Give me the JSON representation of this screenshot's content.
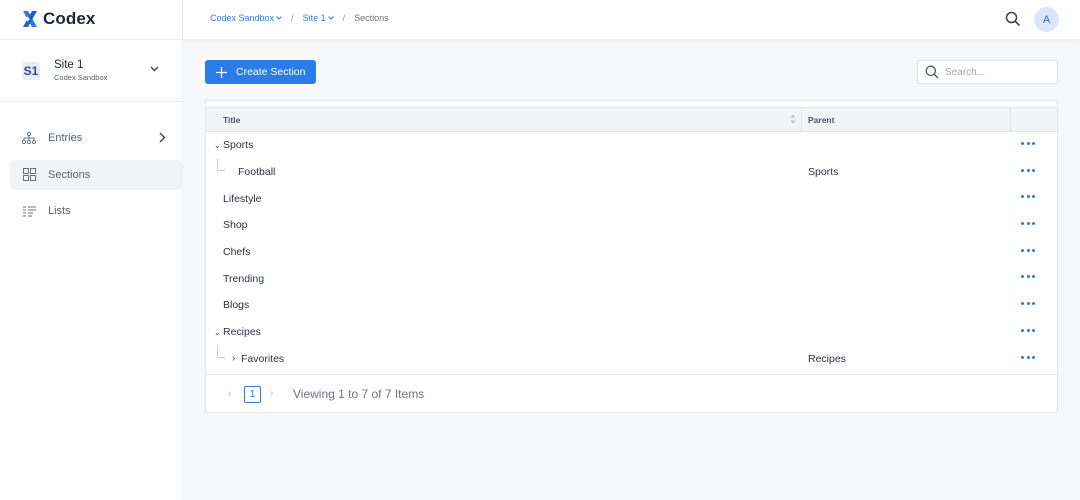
{
  "app": {
    "name": "Codex",
    "brand_color": "#2b7be9"
  },
  "site_switcher": {
    "badge": "S1",
    "name": "Site 1",
    "workspace": "Codex Sandbox"
  },
  "sidebar": {
    "items": [
      {
        "label": "Entries",
        "icon": "hierarchy-icon",
        "active": false
      },
      {
        "label": "Sections",
        "icon": "grid-icon",
        "active": true
      },
      {
        "label": "Lists",
        "icon": "list-icon",
        "active": false
      }
    ]
  },
  "breadcrumb": {
    "workspace": "Codex Sandbox",
    "site": "Site 1",
    "current": "Sections"
  },
  "user": {
    "initial": "A"
  },
  "toolbar": {
    "create_label": "Create Section",
    "search_placeholder": "Search..."
  },
  "table": {
    "columns": {
      "title": "Title",
      "parent": "Parent"
    },
    "rows": [
      {
        "title": "Sports",
        "parent": "",
        "expanded": true,
        "child": false
      },
      {
        "title": "Football",
        "parent": "Sports",
        "expanded": false,
        "child": true
      },
      {
        "title": "Lifestyle",
        "parent": "",
        "expanded": false,
        "child": false
      },
      {
        "title": "Shop",
        "parent": "",
        "expanded": false,
        "child": false
      },
      {
        "title": "Chefs",
        "parent": "",
        "expanded": false,
        "child": false
      },
      {
        "title": "Trending",
        "parent": "",
        "expanded": false,
        "child": false
      },
      {
        "title": "Blogs",
        "parent": "",
        "expanded": false,
        "child": false
      },
      {
        "title": "Recipes",
        "parent": "",
        "expanded": true,
        "child": false
      },
      {
        "title": "Favorites",
        "parent": "Recipes",
        "expanded": false,
        "child": true,
        "collapsible": true
      }
    ]
  },
  "pagination": {
    "page": "1",
    "info": "Viewing 1 to 7 of 7 Items"
  }
}
